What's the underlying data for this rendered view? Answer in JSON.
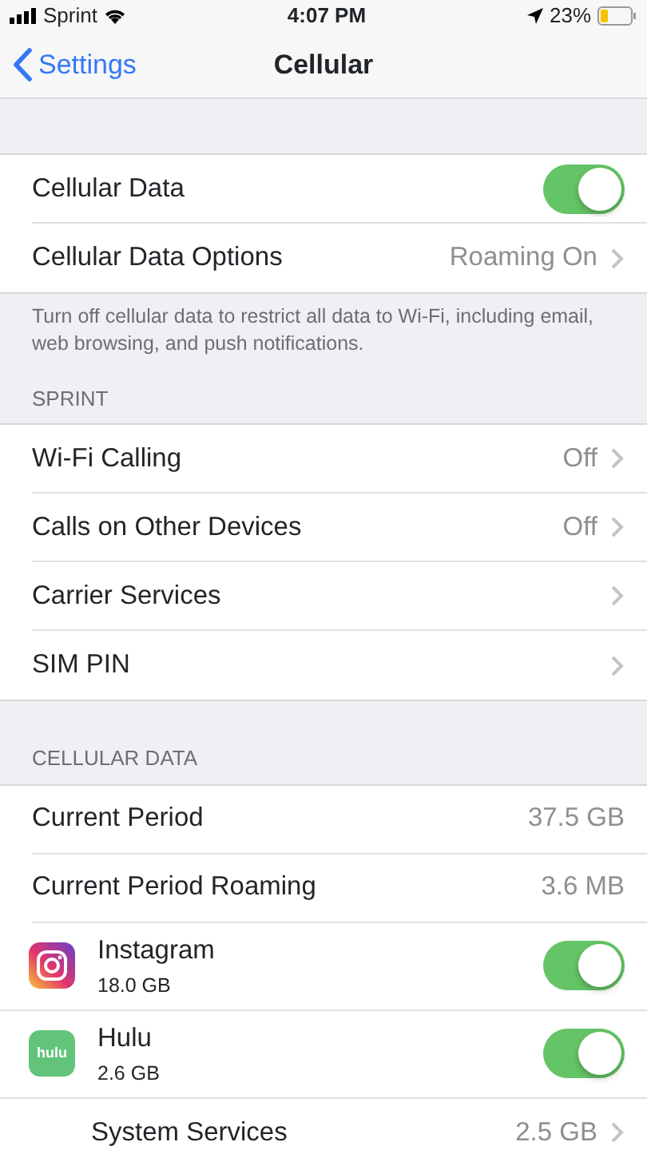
{
  "status_bar": {
    "carrier": "Sprint",
    "time": "4:07 PM",
    "battery": "23%"
  },
  "nav": {
    "back": "Settings",
    "title": "Cellular"
  },
  "sections": [
    {
      "rows": [
        {
          "kind": "toggle",
          "label": "Cellular Data",
          "on": true
        },
        {
          "kind": "detail",
          "label": "Cellular Data Options",
          "value": "Roaming On"
        }
      ],
      "footer": "Turn off cellular data to restrict all data to Wi-Fi, including email, web browsing, and push notifications."
    },
    {
      "header": "SPRINT",
      "rows": [
        {
          "kind": "detail",
          "label": "Wi-Fi Calling",
          "value": "Off"
        },
        {
          "kind": "detail",
          "label": "Calls on Other Devices",
          "value": "Off"
        },
        {
          "kind": "detail",
          "label": "Carrier Services"
        },
        {
          "kind": "detail",
          "label": "SIM PIN"
        }
      ]
    },
    {
      "header": "CELLULAR DATA",
      "rows": [
        {
          "kind": "info",
          "label": "Current Period",
          "value": "37.5 GB"
        },
        {
          "kind": "info",
          "label": "Current Period Roaming",
          "value": "3.6 MB"
        },
        {
          "kind": "app",
          "icon": {
            "kind": "camera"
          },
          "label": "Instagram",
          "usage": "18.0 GB",
          "on": true
        },
        {
          "kind": "app",
          "icon": {
            "kind": "text",
            "text": "hulu"
          },
          "label": "Hulu",
          "usage": "2.6 GB",
          "on": true
        },
        {
          "kind": "detail",
          "indented": true,
          "label": "System Services",
          "value": "2.5 GB"
        }
      ]
    }
  ]
}
